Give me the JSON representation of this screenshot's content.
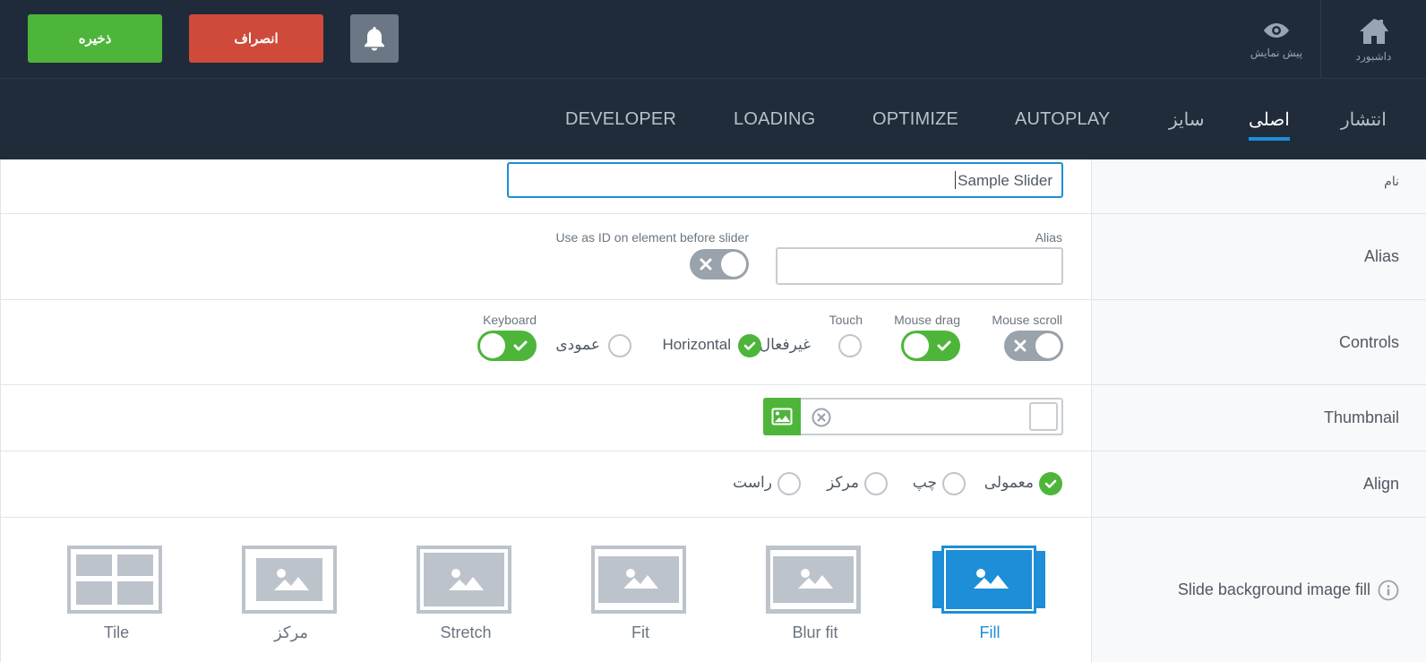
{
  "header": {
    "save_label": "ذخیره",
    "cancel_label": "انصراف",
    "dashboard_label": "داشبورد",
    "preview_label": "پیش نمایش",
    "icons": {
      "bell": "bell-icon",
      "home": "home-icon",
      "eye": "eye-icon"
    },
    "colors": {
      "save": "#4eb53b",
      "cancel": "#cf4a3a",
      "bell": "#6b7784",
      "bar": "#1f2b3a"
    }
  },
  "tabs": [
    {
      "label": "انتشار"
    },
    {
      "label": "اصلی",
      "active": true
    },
    {
      "label": "سایز"
    },
    {
      "label": "AUTOPLAY"
    },
    {
      "label": "OPTIMIZE"
    },
    {
      "label": "LOADING"
    },
    {
      "label": "DEVELOPER"
    }
  ],
  "form": {
    "name": {
      "label": "نام",
      "value": "Sample Slider"
    },
    "alias": {
      "label": "Alias",
      "field_label": "Alias",
      "value": "",
      "id_label": "Use as ID on element before slider",
      "id_toggle": false
    },
    "controls": {
      "label": "Controls",
      "mouse_scroll": {
        "label": "Mouse scroll",
        "on": false
      },
      "mouse_drag": {
        "label": "Mouse drag",
        "on": true
      },
      "touch": {
        "label": "Touch",
        "options": [
          "غیرفعال",
          "Horizontal",
          "عمودی"
        ],
        "selected": "Horizontal"
      },
      "keyboard": {
        "label": "Keyboard",
        "on": true
      }
    },
    "thumbnail": {
      "label": "Thumbnail",
      "value": ""
    },
    "align": {
      "label": "Align",
      "options": [
        "معمولی",
        "چپ",
        "مرکز",
        "راست"
      ],
      "selected": "معمولی"
    },
    "background_fill": {
      "label": "Slide background image fill",
      "options": [
        "Fill",
        "Blur fit",
        "Fit",
        "Stretch",
        "مرکز",
        "Tile"
      ],
      "selected": "Fill",
      "accent": "#1e8ed8"
    }
  }
}
